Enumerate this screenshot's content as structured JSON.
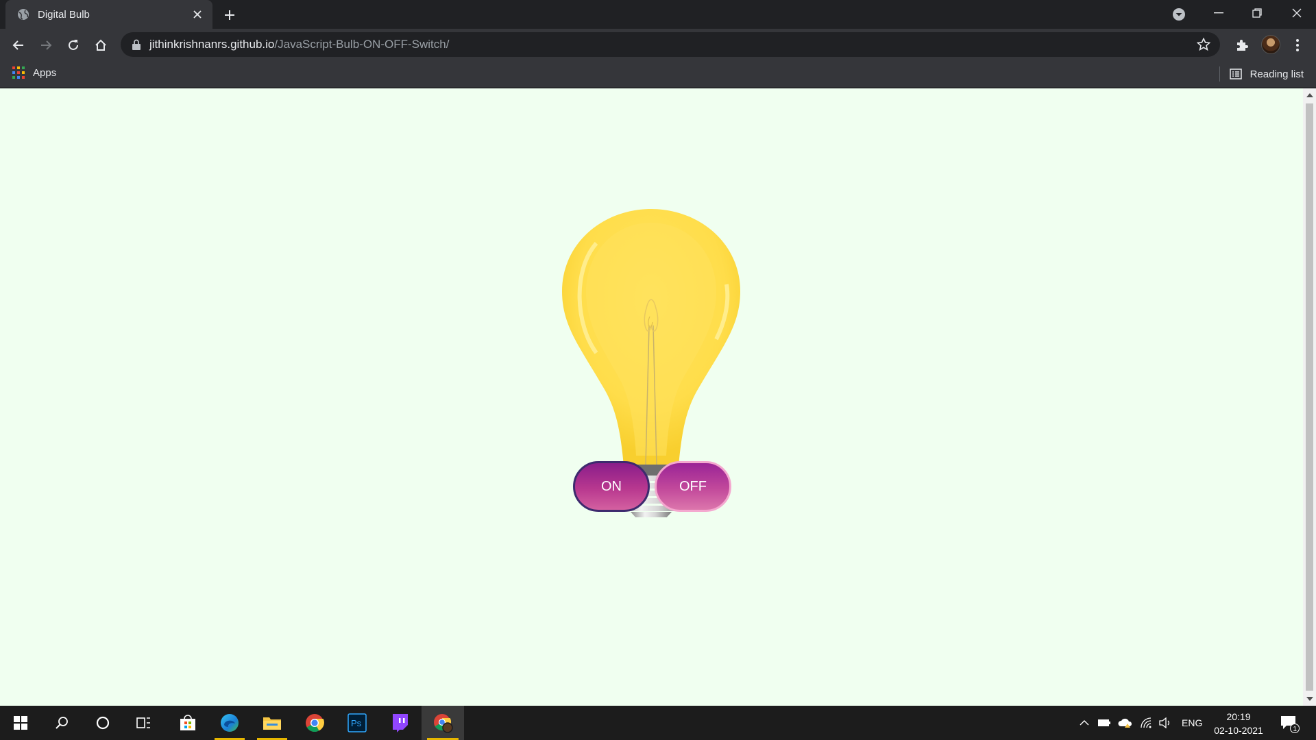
{
  "browser": {
    "tab_title": "Digital Bulb",
    "url_host": "jithinkrishnanrs.github.io",
    "url_path": "/JavaScript-Bulb-ON-OFF-Switch/"
  },
  "bookmarks": {
    "apps_label": "Apps",
    "reading_list_label": "Reading list"
  },
  "page": {
    "background": "#f0fff0",
    "bulb_state": "on",
    "on_label": "ON",
    "off_label": "OFF"
  },
  "taskbar": {
    "language": "ENG",
    "time": "20:19",
    "date": "02-10-2021",
    "notification_count": "1",
    "apps": [
      "start-icon",
      "search-icon",
      "cortana-icon",
      "task-view-icon",
      "microsoft-store-icon",
      "edge-icon",
      "file-explorer-icon",
      "chrome-icon",
      "photoshop-icon",
      "twitch-icon",
      "chrome-profile-icon"
    ]
  }
}
